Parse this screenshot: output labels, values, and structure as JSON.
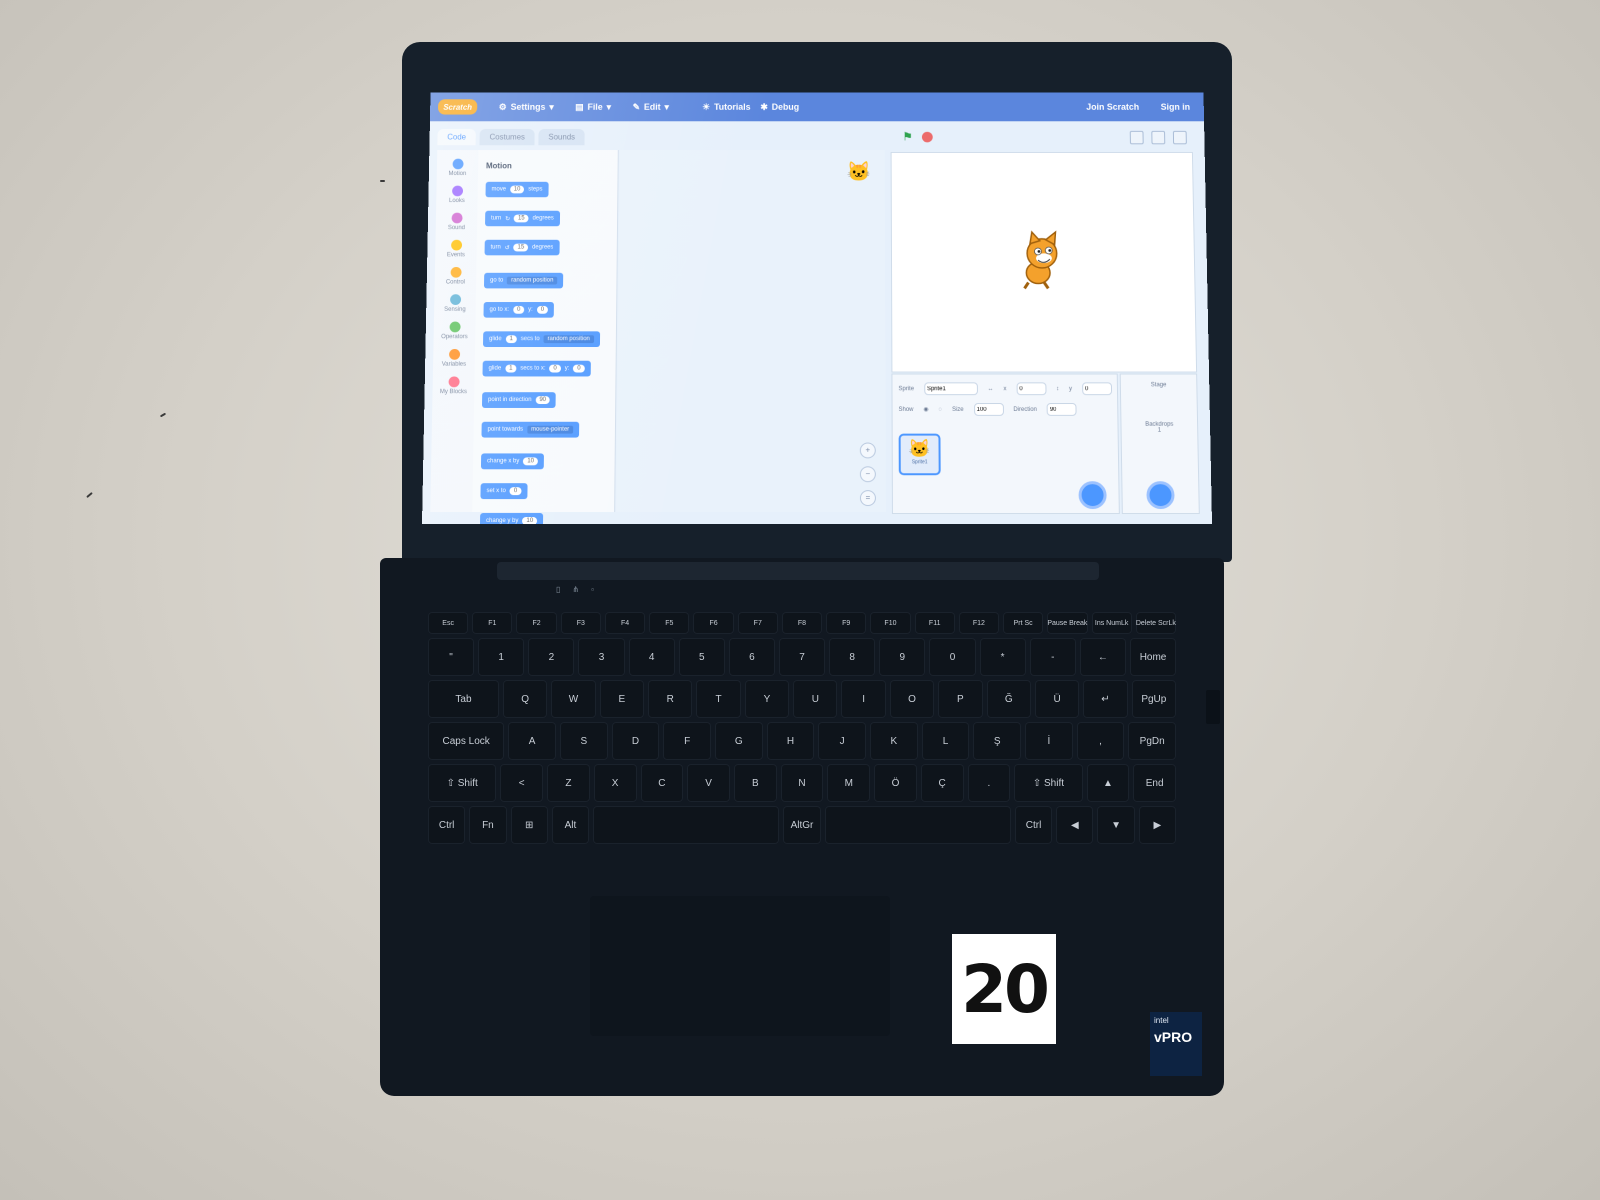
{
  "menu": {
    "logo": "Scratch",
    "settings": "Settings",
    "file": "File",
    "edit": "Edit",
    "tutorials": "Tutorials",
    "debug": "Debug",
    "join": "Join Scratch",
    "signin": "Sign in"
  },
  "tabs": [
    "Code",
    "Costumes",
    "Sounds"
  ],
  "categories": [
    {
      "label": "Motion",
      "color": "#4c97ff"
    },
    {
      "label": "Looks",
      "color": "#9966ff"
    },
    {
      "label": "Sound",
      "color": "#cf63cf"
    },
    {
      "label": "Events",
      "color": "#ffbf00"
    },
    {
      "label": "Control",
      "color": "#ffab19"
    },
    {
      "label": "Sensing",
      "color": "#5cb1d6"
    },
    {
      "label": "Operators",
      "color": "#59c059"
    },
    {
      "label": "Variables",
      "color": "#ff8c1a"
    },
    {
      "label": "My Blocks",
      "color": "#ff6680"
    }
  ],
  "palette": {
    "heading": "Motion",
    "blocks": {
      "move": "move",
      "move_val": "10",
      "move_unit": "steps",
      "turn_r": "turn",
      "turn_r_val": "15",
      "turn_r_unit": "degrees",
      "turn_l": "turn",
      "turn_l_val": "15",
      "turn_l_unit": "degrees",
      "goto": "go to",
      "goto_opt": "random position",
      "gotoxy": "go to x:",
      "gotoxy_x": "0",
      "gotoxy_y_label": "y:",
      "gotoxy_y": "0",
      "glide": "glide",
      "glide_val": "1",
      "glide_mid": "secs to",
      "glide_opt": "random position",
      "glidexy": "glide",
      "glidexy_val": "1",
      "glidexy_mid": "secs to x:",
      "glidexy_x": "0",
      "glidexy_y_label": "y:",
      "glidexy_y": "0",
      "point": "point in direction",
      "point_val": "90",
      "towards": "point towards",
      "towards_opt": "mouse-pointer",
      "changex": "change x by",
      "changex_val": "10",
      "setx": "set x to",
      "setx_val": "0",
      "changey": "change y by",
      "changey_val": "10"
    }
  },
  "sprite_info": {
    "sprite_label": "Sprite",
    "sprite_name": "Sprite1",
    "x_label": "x",
    "x_val": "0",
    "y_label": "y",
    "y_val": "0",
    "show_label": "Show",
    "size_label": "Size",
    "size_val": "100",
    "direction_label": "Direction",
    "direction_val": "90",
    "thumb_name": "Sprite1"
  },
  "stage_pane": {
    "title": "Stage",
    "backdrops_label": "Backdrops",
    "backdrops_count": "1"
  },
  "keyboard": {
    "frow": [
      "Esc",
      "F1",
      "F2",
      "F3",
      "F4",
      "F5",
      "F6",
      "F7",
      "F8",
      "F9",
      "F10",
      "F11",
      "F12",
      "Prt Sc",
      "Pause Break",
      "Ins NumLk",
      "Delete ScrLk"
    ],
    "row1": [
      "\"",
      "1",
      "2",
      "3",
      "4",
      "5",
      "6",
      "7",
      "8",
      "9",
      "0",
      "*",
      "-",
      "←",
      "Home"
    ],
    "row2": [
      "Tab",
      "Q",
      "W",
      "E",
      "R",
      "T",
      "Y",
      "U",
      "I",
      "O",
      "P",
      "Ğ",
      "Ü",
      "↵",
      "PgUp"
    ],
    "row3": [
      "Caps Lock",
      "A",
      "S",
      "D",
      "F",
      "G",
      "H",
      "J",
      "K",
      "L",
      "Ş",
      "İ",
      ",",
      "PgDn"
    ],
    "row4": [
      "⇧ Shift",
      "<",
      "Z",
      "X",
      "C",
      "V",
      "B",
      "N",
      "M",
      "Ö",
      "Ç",
      ".",
      "⇧ Shift",
      "▲",
      "End"
    ],
    "row5": [
      "Ctrl",
      "Fn",
      "⊞",
      "Alt",
      "",
      "AltGr",
      "",
      "Ctrl",
      "◀",
      "▼",
      "▶"
    ]
  },
  "tag_number": "20",
  "sticker": {
    "brand": "intel",
    "model": "vPRO"
  }
}
